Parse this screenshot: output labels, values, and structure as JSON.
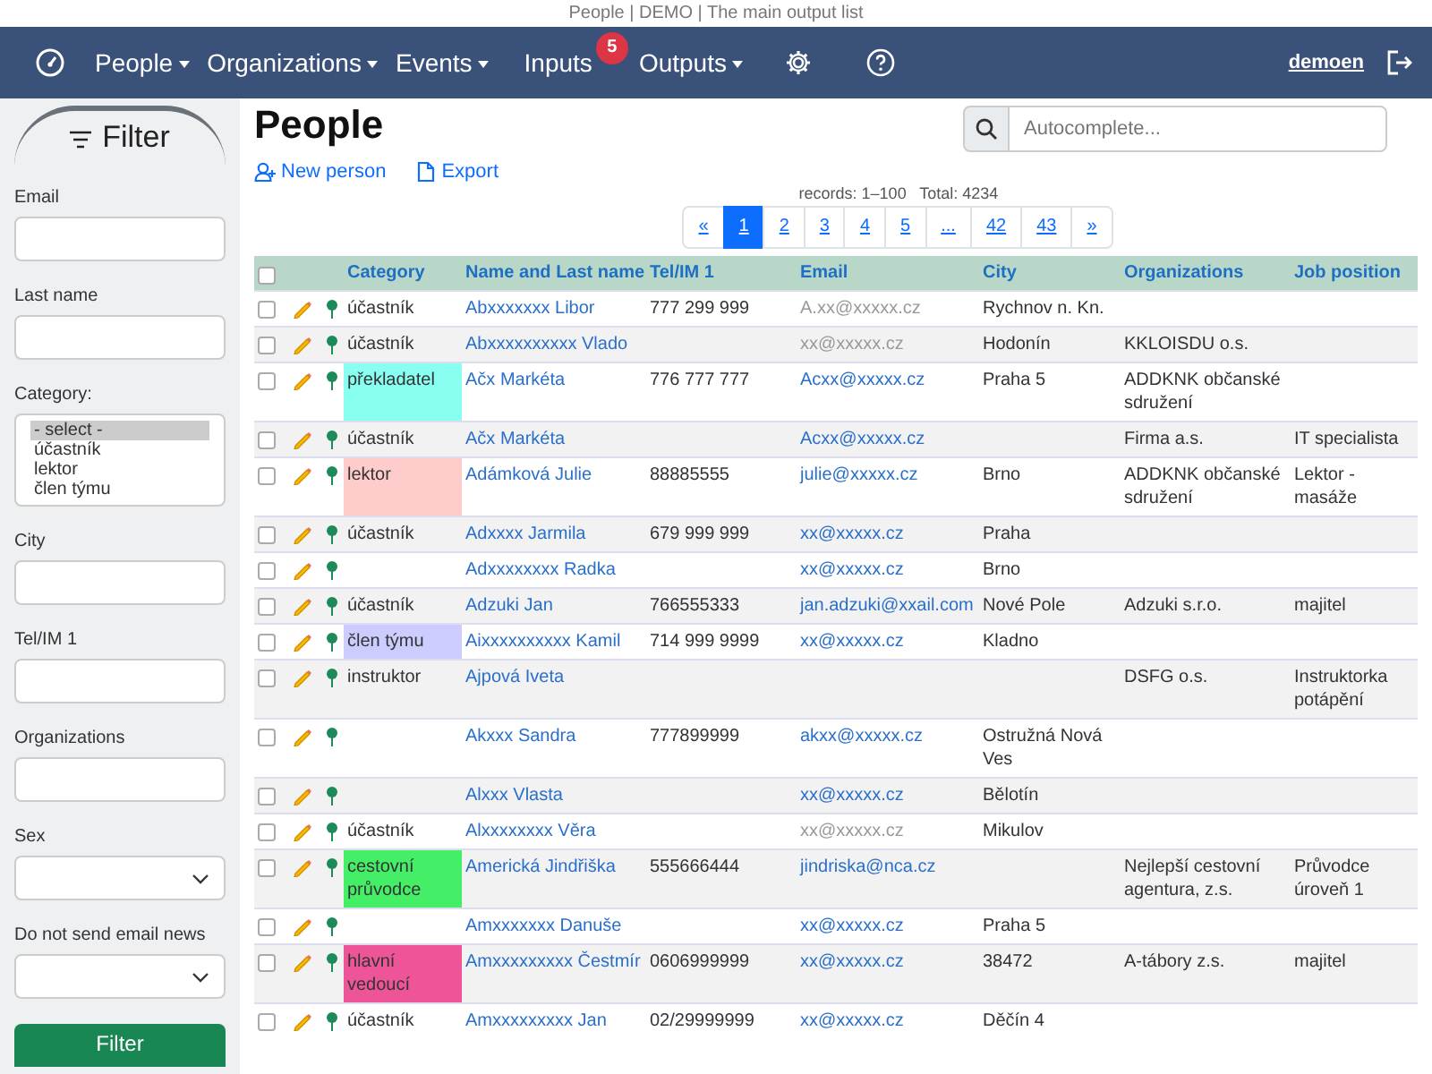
{
  "window": {
    "title": "People | DEMO | The main output list"
  },
  "navbar": {
    "items": [
      {
        "label": "People",
        "dropdown": true
      },
      {
        "label": "Organizations",
        "dropdown": true
      },
      {
        "label": "Events",
        "dropdown": true
      },
      {
        "label": "Inputs",
        "dropdown": false,
        "badge": "5"
      },
      {
        "label": "Outputs",
        "dropdown": true
      }
    ],
    "user": "demoen"
  },
  "sidebar": {
    "title": "Filter",
    "fields": [
      {
        "label": "Email",
        "kind": "text"
      },
      {
        "label": "Last name",
        "kind": "text"
      },
      {
        "label": "Category:",
        "kind": "list",
        "options": [
          {
            "label": "- select -",
            "selected": true
          },
          {
            "label": "účastník",
            "selected": false
          },
          {
            "label": "lektor",
            "selected": false
          },
          {
            "label": "člen týmu",
            "selected": false
          }
        ]
      },
      {
        "label": "City",
        "kind": "text"
      },
      {
        "label": "Tel/IM 1",
        "kind": "text"
      },
      {
        "label": "Organizations",
        "kind": "text"
      },
      {
        "label": "Sex",
        "kind": "select"
      },
      {
        "label": "Do not send email news",
        "kind": "select"
      }
    ],
    "button": "Filter"
  },
  "page": {
    "title": "People",
    "search": {
      "placeholder": "Autocomplete..."
    },
    "actions": [
      "New person",
      "Export"
    ],
    "records": "records: 1–100",
    "total": "Total: 4234",
    "pagination": [
      {
        "label": "«",
        "selected": false
      },
      {
        "label": "1",
        "selected": true
      },
      {
        "label": "2",
        "selected": false
      },
      {
        "label": "3",
        "selected": false
      },
      {
        "label": "4",
        "selected": false
      },
      {
        "label": "5",
        "selected": false
      },
      {
        "label": "...",
        "selected": false
      },
      {
        "label": "42",
        "selected": false
      },
      {
        "label": "43",
        "selected": false
      },
      {
        "label": "»",
        "selected": false
      }
    ]
  },
  "table": {
    "all_checked": false,
    "columns": [
      "Category",
      "Name and Last name",
      "Tel/IM 1",
      "Email",
      "City",
      "Organizations",
      "Job position"
    ],
    "rows": [
      {
        "checked": false,
        "category": "účastník",
        "name": "Abxxxxxxx Libor",
        "tel": "777 299 999",
        "email": "A.xx@xxxxx.cz",
        "email_muted": true,
        "city": "Rychnov n. Kn."
      },
      {
        "checked": false,
        "category": "účastník",
        "name": "Abxxxxxxxxxx Vlado",
        "email": "xx@xxxxx.cz",
        "email_muted": true,
        "city": "Hodonín",
        "org": "KKLOISDU o.s."
      },
      {
        "checked": false,
        "category": "překladatel",
        "color": "#88fff0",
        "name": "Ačx Markéta",
        "tel": "776 777 777",
        "email": "Acxx@xxxxx.cz",
        "email_muted": false,
        "city": "Praha 5",
        "org": "ADDKNK občanské sdružení"
      },
      {
        "checked": false,
        "category": "účastník",
        "name": "Ačx Markéta",
        "email": "Acxx@xxxxx.cz",
        "email_muted": false,
        "org": "Firma a.s.",
        "job": "IT specialista"
      },
      {
        "checked": false,
        "category": "lektor",
        "color": "#ffcccc",
        "name": "Adámková Julie",
        "tel": "88885555",
        "email": "julie@xxxxx.cz",
        "email_muted": false,
        "city": "Brno",
        "org": "ADDKNK občanské sdružení",
        "job": "Lektor - masáže"
      },
      {
        "checked": false,
        "category": "účastník",
        "name": "Adxxxx Jarmila",
        "tel": "679 999 999",
        "email": "xx@xxxxx.cz",
        "email_muted": false,
        "city": "Praha"
      },
      {
        "checked": false,
        "name": "Adxxxxxxxx Radka",
        "email": "xx@xxxxx.cz",
        "email_muted": false,
        "city": "Brno"
      },
      {
        "checked": false,
        "category": "účastník",
        "name": "Adzuki Jan",
        "tel": "766555333",
        "email": "jan.adzuki@xxail.com",
        "email_muted": false,
        "city": "Nové Pole",
        "org": "Adzuki s.r.o.",
        "job": "majitel"
      },
      {
        "checked": false,
        "category": "člen týmu",
        "color": "#ccccff",
        "name": "Aixxxxxxxxxx Kamil",
        "tel": "714 999 9999",
        "email": "xx@xxxxx.cz",
        "email_muted": false,
        "city": "Kladno"
      },
      {
        "checked": false,
        "category": "instruktor",
        "name": "Ajpová Iveta",
        "org": "DSFG o.s.",
        "job": "Instruktorka potápění"
      },
      {
        "checked": false,
        "name": "Akxxx Sandra",
        "tel": "777899999",
        "email": "akxx@xxxxx.cz",
        "email_muted": false,
        "city": "Ostružná Nová Ves"
      },
      {
        "checked": false,
        "name": "Alxxx Vlasta",
        "email": "xx@xxxxx.cz",
        "email_muted": false,
        "city": "Bělotín"
      },
      {
        "checked": false,
        "category": "účastník",
        "name": "Alxxxxxxxx Věra",
        "email": "xx@xxxxx.cz",
        "email_muted": true,
        "city": "Mikulov"
      },
      {
        "checked": false,
        "category": "cestovní průvodce",
        "color": "#44ee66",
        "name": "Americká Jindřiška",
        "tel": "555666444",
        "email": "jindriska@nca.cz",
        "email_muted": false,
        "org": "Nejlepší cestovní agentura, z.s.",
        "job": "Průvodce úroveň 1"
      },
      {
        "checked": false,
        "name": "Amxxxxxxx Danuše",
        "email": "xx@xxxxx.cz",
        "email_muted": false,
        "city": "Praha 5"
      },
      {
        "checked": false,
        "category": "hlavní vedoucí",
        "color": "#ee5599",
        "name": "Amxxxxxxxxx Čestmír",
        "tel": "0606999999",
        "email": "xx@xxxxx.cz",
        "email_muted": false,
        "city": "38472",
        "org": "A-tábory z.s.",
        "job": "majitel"
      },
      {
        "checked": false,
        "category": "účastník",
        "name": "Amxxxxxxxxx Jan",
        "tel": "02/29999999",
        "email": "xx@xxxxx.cz",
        "email_muted": false,
        "city": "Děčín 4"
      }
    ]
  }
}
